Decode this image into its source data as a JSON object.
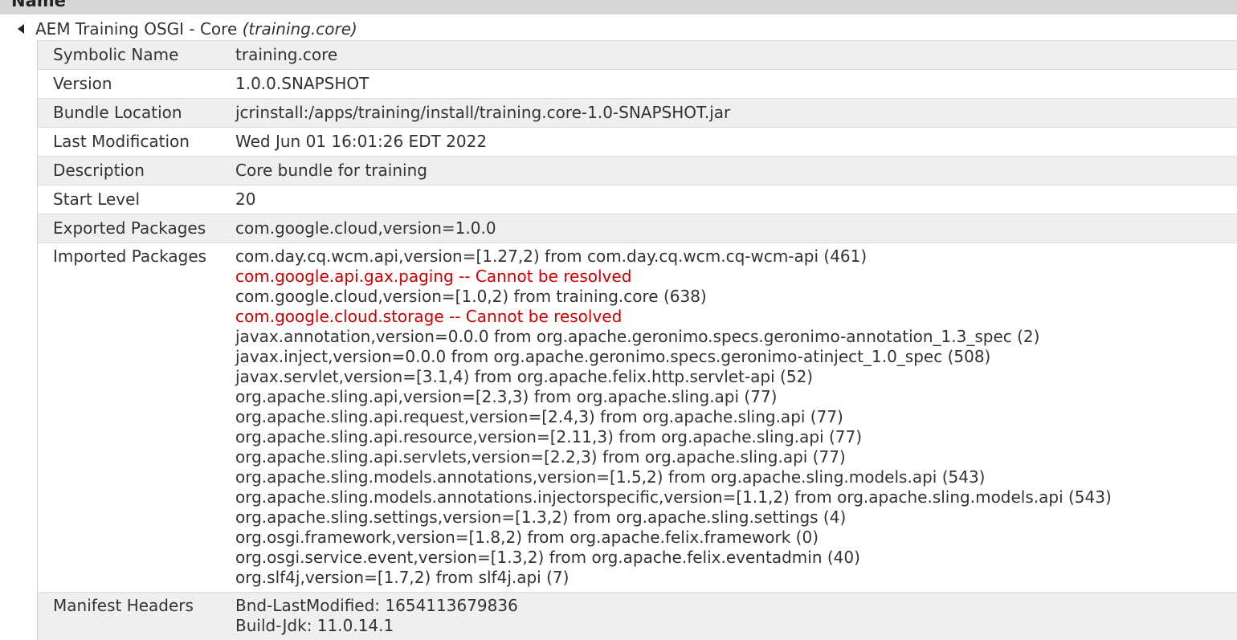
{
  "header": {
    "column_label": "Name"
  },
  "bundle": {
    "name": "AEM Training OSGI - Core",
    "symbolic_paren": "(training.core)"
  },
  "details": {
    "symbolic_name": {
      "label": "Symbolic Name",
      "value": "training.core"
    },
    "version": {
      "label": "Version",
      "value": "1.0.0.SNAPSHOT"
    },
    "bundle_location": {
      "label": "Bundle Location",
      "value": "jcrinstall:/apps/training/install/training.core-1.0-SNAPSHOT.jar"
    },
    "last_modification": {
      "label": "Last Modification",
      "value": "Wed Jun 01 16:01:26 EDT 2022"
    },
    "description": {
      "label": "Description",
      "value": "Core bundle for training"
    },
    "start_level": {
      "label": "Start Level",
      "value": "20"
    },
    "exported_packages": {
      "label": "Exported Packages",
      "value": "com.google.cloud,version=1.0.0"
    },
    "imported_packages": {
      "label": "Imported Packages",
      "lines": [
        {
          "text": "com.day.cq.wcm.api,version=[1.27,2) from com.day.cq.wcm.cq-wcm-api (461)",
          "error": false
        },
        {
          "text": "com.google.api.gax.paging -- Cannot be resolved",
          "error": true
        },
        {
          "text": "com.google.cloud,version=[1.0,2) from training.core (638)",
          "error": false
        },
        {
          "text": "com.google.cloud.storage -- Cannot be resolved",
          "error": true
        },
        {
          "text": "javax.annotation,version=0.0.0 from org.apache.geronimo.specs.geronimo-annotation_1.3_spec (2)",
          "error": false
        },
        {
          "text": "javax.inject,version=0.0.0 from org.apache.geronimo.specs.geronimo-atinject_1.0_spec (508)",
          "error": false
        },
        {
          "text": "javax.servlet,version=[3.1,4) from org.apache.felix.http.servlet-api (52)",
          "error": false
        },
        {
          "text": "org.apache.sling.api,version=[2.3,3) from org.apache.sling.api (77)",
          "error": false
        },
        {
          "text": "org.apache.sling.api.request,version=[2.4,3) from org.apache.sling.api (77)",
          "error": false
        },
        {
          "text": "org.apache.sling.api.resource,version=[2.11,3) from org.apache.sling.api (77)",
          "error": false
        },
        {
          "text": "org.apache.sling.api.servlets,version=[2.2,3) from org.apache.sling.api (77)",
          "error": false
        },
        {
          "text": "org.apache.sling.models.annotations,version=[1.5,2) from org.apache.sling.models.api (543)",
          "error": false
        },
        {
          "text": "org.apache.sling.models.annotations.injectorspecific,version=[1.1,2) from org.apache.sling.models.api (543)",
          "error": false
        },
        {
          "text": "org.apache.sling.settings,version=[1.3,2) from org.apache.sling.settings (4)",
          "error": false
        },
        {
          "text": "org.osgi.framework,version=[1.8,2) from org.apache.felix.framework (0)",
          "error": false
        },
        {
          "text": "org.osgi.service.event,version=[1.3,2) from org.apache.felix.eventadmin (40)",
          "error": false
        },
        {
          "text": "org.slf4j,version=[1.7,2) from slf4j.api (7)",
          "error": false
        }
      ]
    },
    "manifest_headers": {
      "label": "Manifest Headers",
      "lines": [
        "Bnd-LastModified: 1654113679836",
        "Build-Jdk: 11.0.14.1"
      ]
    }
  },
  "colors": {
    "error": "#cc0000",
    "row_shade": "#efefef",
    "header_bar": "#d6d6d6"
  },
  "icons": {
    "toggle": "collapse-triangle-left-icon"
  }
}
